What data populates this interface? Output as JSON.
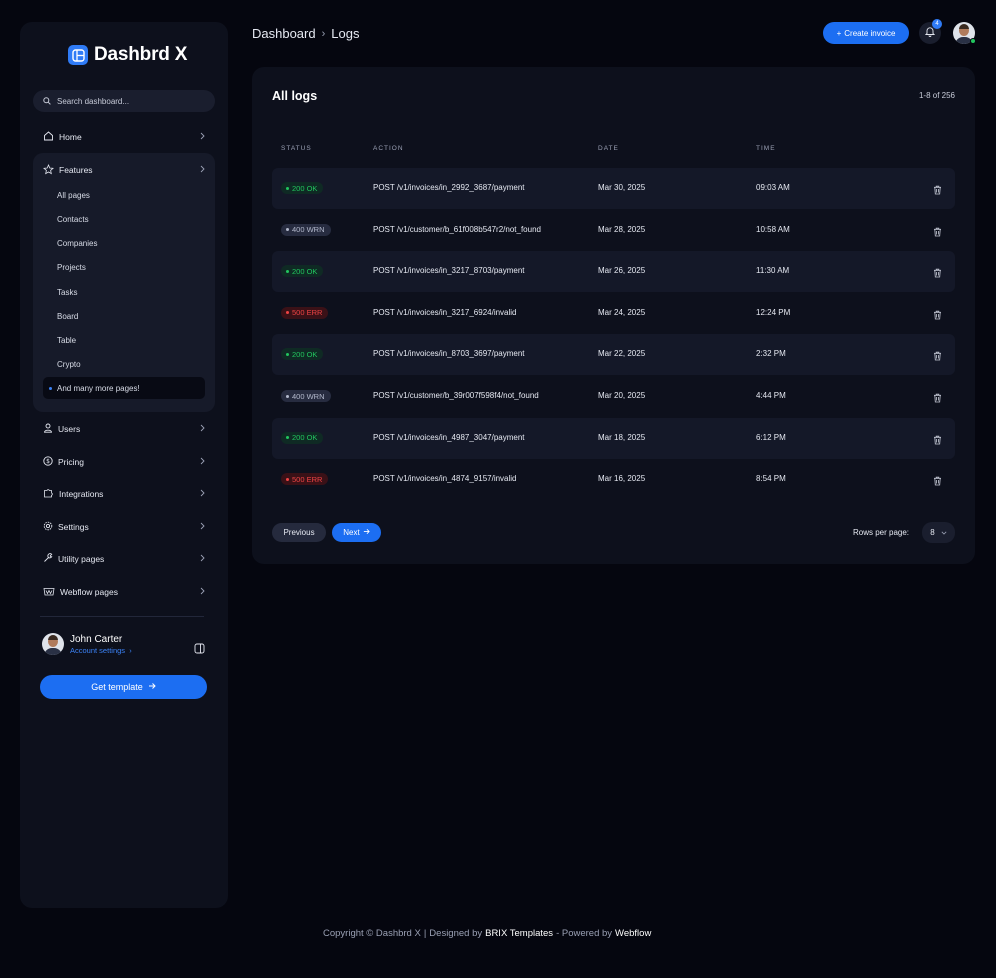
{
  "brand": {
    "name": "Dashbrd X"
  },
  "search": {
    "placeholder": "Search dashboard..."
  },
  "sidebar": {
    "home": "Home",
    "features": "Features",
    "features_items": [
      "All pages",
      "Contacts",
      "Companies",
      "Projects",
      "Tasks",
      "Board",
      "Table",
      "Crypto",
      "And many more pages!"
    ],
    "users": "Users",
    "pricing": "Pricing",
    "integrations": "Integrations",
    "settings": "Settings",
    "utility": "Utility pages",
    "webflow": "Webflow pages"
  },
  "user": {
    "name": "John Carter",
    "link": "Account settings"
  },
  "get_template": "Get template",
  "header": {
    "breadcrumb_root": "Dashboard",
    "breadcrumb_current": "Logs",
    "create_label": "Create invoice",
    "notification_count": "4"
  },
  "logs": {
    "title": "All logs",
    "count": "1-8 of 256",
    "columns": [
      "STATUS",
      "ACTION",
      "DATE",
      "TIME"
    ],
    "rows": [
      {
        "status": "200 OK",
        "kind": "ok",
        "action": "POST /v1/invoices/in_2992_3687/payment",
        "date": "Mar 30, 2025",
        "time": "09:03 AM"
      },
      {
        "status": "400 WRN",
        "kind": "wrn",
        "action": "POST /v1/customer/b_61f008b547r2/not_found",
        "date": "Mar 28, 2025",
        "time": "10:58 AM"
      },
      {
        "status": "200 OK",
        "kind": "ok",
        "action": "POST /v1/invoices/in_3217_8703/payment",
        "date": "Mar 26, 2025",
        "time": "11:30 AM"
      },
      {
        "status": "500 ERR",
        "kind": "err",
        "action": "POST /v1/invoices/in_3217_6924/invalid",
        "date": "Mar 24, 2025",
        "time": "12:24 PM"
      },
      {
        "status": "200 OK",
        "kind": "ok",
        "action": "POST /v1/invoices/in_8703_3697/payment",
        "date": "Mar 22, 2025",
        "time": "2:32 PM"
      },
      {
        "status": "400 WRN",
        "kind": "wrn",
        "action": "POST /v1/customer/b_39r007f598f4/not_found",
        "date": "Mar 20, 2025",
        "time": "4:44 PM"
      },
      {
        "status": "200 OK",
        "kind": "ok",
        "action": "POST /v1/invoices/in_4987_3047/payment",
        "date": "Mar 18, 2025",
        "time": "6:12 PM"
      },
      {
        "status": "500 ERR",
        "kind": "err",
        "action": "POST /v1/invoices/in_4874_9157/invalid",
        "date": "Mar 16, 2025",
        "time": "8:54 PM"
      }
    ]
  },
  "pagination": {
    "previous": "Previous",
    "next": "Next",
    "rows_label": "Rows per page:",
    "rows_value": "8"
  },
  "footer": {
    "copyright": "Copyright © Dashbrd X",
    "designed_by": "Designed by",
    "brix": "BRIX Templates",
    "powered": "- Powered by",
    "webflow": "Webflow"
  },
  "colors": {
    "accent": "#1c6ef2",
    "ok": "#22c55e",
    "err": "#ef4444",
    "background": "#05060f",
    "panel": "#0d101c"
  }
}
